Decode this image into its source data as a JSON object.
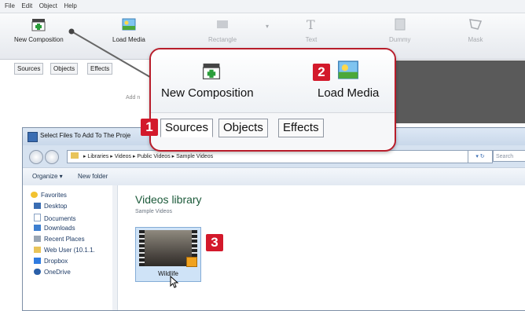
{
  "app": {
    "menu": [
      "File",
      "Edit",
      "Object",
      "Help"
    ],
    "toolbar": {
      "new_composition": "New Composition",
      "load_media": "Load Media",
      "disabled_labels": [
        "Rectangle",
        "Text",
        "Dummy",
        "Mask"
      ]
    },
    "left_tabs": [
      "Sources",
      "Objects",
      "Effects"
    ],
    "add_hint": "Add n"
  },
  "callout": {
    "new_composition": "New Composition",
    "load_media": "Load Media",
    "tabs": [
      "Sources",
      "Objects",
      "Effects"
    ],
    "badges": [
      "1",
      "2",
      "3"
    ]
  },
  "dialog": {
    "title": "Select Files To Add To The Proje",
    "breadcrumb": [
      "Libraries",
      "Videos",
      "Public Videos",
      "Sample Videos"
    ],
    "search_placeholder": "Search",
    "commands": {
      "organize": "Organize ▾",
      "new_folder": "New folder"
    },
    "nav": [
      {
        "label": "Favorites",
        "icon": "star-icon"
      },
      {
        "label": "Desktop",
        "icon": "desktop-icon"
      },
      {
        "label": "Documents",
        "icon": "documents-icon"
      },
      {
        "label": "Downloads",
        "icon": "downloads-icon"
      },
      {
        "label": "Recent Places",
        "icon": "recent-places-icon"
      },
      {
        "label": "Web User (10.1.1.",
        "icon": "folder-icon"
      },
      {
        "label": "Dropbox",
        "icon": "dropbox-icon"
      },
      {
        "label": "OneDrive",
        "icon": "onedrive-icon"
      }
    ],
    "library_title": "Videos library",
    "library_subtitle": "Sample Videos",
    "file": {
      "name": "Wildlife"
    }
  },
  "colors": {
    "accent_red": "#d3192b",
    "callout_border": "#b81d2b",
    "library_green": "#1c5a3a"
  }
}
